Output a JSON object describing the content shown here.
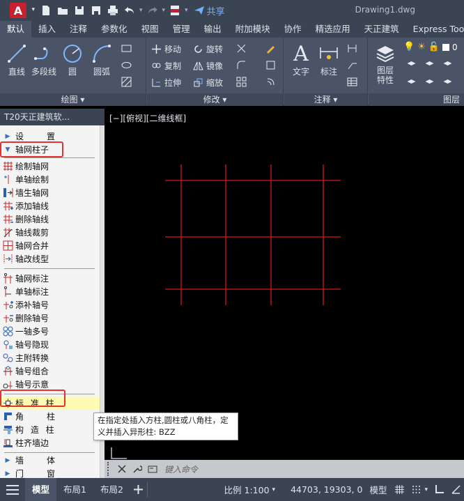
{
  "titlebar": {
    "app_logo_letter": "A",
    "share_label": "共享",
    "document_title": "Drawing1.dwg",
    "quick_access": [
      "new-file-icon",
      "open-folder-icon",
      "save-icon",
      "save-as-icon",
      "print-icon",
      "undo-icon",
      "redo-icon",
      "dwf-export-icon"
    ]
  },
  "ribbon_tabs": [
    "默认",
    "插入",
    "注释",
    "参数化",
    "视图",
    "管理",
    "输出",
    "附加模块",
    "协作",
    "精选应用",
    "天正建筑",
    "Express Tools"
  ],
  "ribbon": {
    "draw": {
      "title": "绘图",
      "line": "直线",
      "polyline": "多段线",
      "circle": "圆",
      "arc": "圆弧"
    },
    "modify": {
      "title": "修改",
      "move": "移动",
      "rotate": "旋转",
      "copy": "复制",
      "mirror": "镜像",
      "stretch": "拉伸",
      "scale": "缩放"
    },
    "annotation": {
      "title": "注释",
      "text": "文字",
      "dimension": "标注"
    },
    "layers": {
      "title": "图层",
      "properties": "图层\n特性",
      "current_layer": "0"
    }
  },
  "palette": {
    "title": "T20天正建筑软...",
    "sections": {
      "settings": "设　　置",
      "grid_column": "轴网柱子",
      "wall": "墙　　体",
      "door_window": "门　　窗"
    },
    "grid_items": [
      "绘制轴网",
      "单轴绘制",
      "墙生轴网",
      "添加轴线",
      "删除轴线",
      "轴线裁剪",
      "轴网合并",
      "轴改线型"
    ],
    "label_items": [
      "轴网标注",
      "单轴标注",
      "添补轴号",
      "删除轴号",
      "一轴多号",
      "轴号隐现",
      "主附转换",
      "轴号组合",
      "轴号示意"
    ],
    "column_items": [
      "标 准 柱",
      "角　　柱",
      "构 造 柱",
      "柱齐墙边"
    ]
  },
  "viewport": {
    "label": "[−][俯视][二维线框]"
  },
  "tooltip": {
    "line1": "在指定处插入方柱,圆柱或八角柱，定",
    "line2": "义并插入异形柱: BZZ"
  },
  "command_line": {
    "placeholder": "键入命令"
  },
  "statusbar": {
    "tabs": [
      "模型",
      "布局1",
      "布局2"
    ],
    "scale": "比例 1:100",
    "coordinates": "44703, 19303, 0",
    "space": "模型"
  },
  "colors": {
    "chrome_dark": "#3b4453",
    "ribbon_bg": "#4a5466",
    "grid_line": "#d21a1a",
    "highlight": "#fffbb0",
    "callout": "#e5312f"
  }
}
